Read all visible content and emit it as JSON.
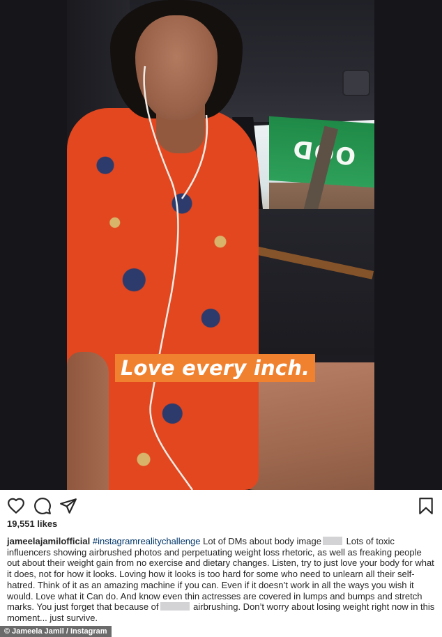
{
  "post": {
    "image": {
      "caption_banner": "Love every inch.",
      "background_sign_text": "OOD",
      "banner_color": "#f0812f"
    },
    "actions": {
      "like_icon": "heart-outline-icon",
      "comment_icon": "comment-bubble-icon",
      "share_icon": "paper-plane-icon",
      "save_icon": "bookmark-icon"
    },
    "likes_count": "19,551 likes",
    "caption": {
      "username": "jameelajamilofficial",
      "hashtag": "#instagramrealitychallenge",
      "text_part1": " Lot of DMs about body image",
      "text_part2": " Lots of toxic influencers showing airbrushed photos and perpetuating weight loss rhetoric, as well as freaking people out about their weight gain from no exercise and dietary changes. Listen, try to just love your body for what it does, not for how it looks. Loving how it looks is too hard for some who need to unlearn all their self-hatred. Think of it as an amazing machine if you can. Even if it doesn’t work in all the ways you wish it would. Love what it Can do. And know even thin actresses are covered in lumps and bumps and stretch marks. You just forget that because of",
      "text_part3": " airbrushing. Don’t worry about losing weight right now in this moment... just survive."
    }
  },
  "credit": "© Jameela Jamil / Instagram"
}
